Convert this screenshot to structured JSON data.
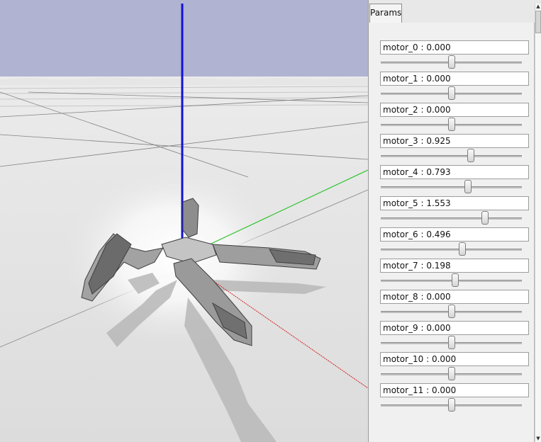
{
  "panel": {
    "tab_label": "Params",
    "params": [
      {
        "label": "motor_0 : 0.000",
        "fraction": 0.5
      },
      {
        "label": "motor_1 : 0.000",
        "fraction": 0.5
      },
      {
        "label": "motor_2 : 0.000",
        "fraction": 0.5
      },
      {
        "label": "motor_3 : 0.925",
        "fraction": 0.64
      },
      {
        "label": "motor_4 : 0.793",
        "fraction": 0.62
      },
      {
        "label": "motor_5 : 1.553",
        "fraction": 0.74
      },
      {
        "label": "motor_6 : 0.496",
        "fraction": 0.58
      },
      {
        "label": "motor_7 : 0.198",
        "fraction": 0.53
      },
      {
        "label": "motor_8 : 0.000",
        "fraction": 0.5
      },
      {
        "label": "motor_9 : 0.000",
        "fraction": 0.5
      },
      {
        "label": "motor_10 : 0.000",
        "fraction": 0.5
      },
      {
        "label": "motor_11 : 0.000",
        "fraction": 0.5
      }
    ]
  },
  "scene": {
    "sky_color": "#b0b3d1",
    "ground_color": "#e3e3e3",
    "axis_z_color": "#1212d8",
    "axis_y_color": "#2ec42e",
    "axis_x_color": "#d42020"
  }
}
